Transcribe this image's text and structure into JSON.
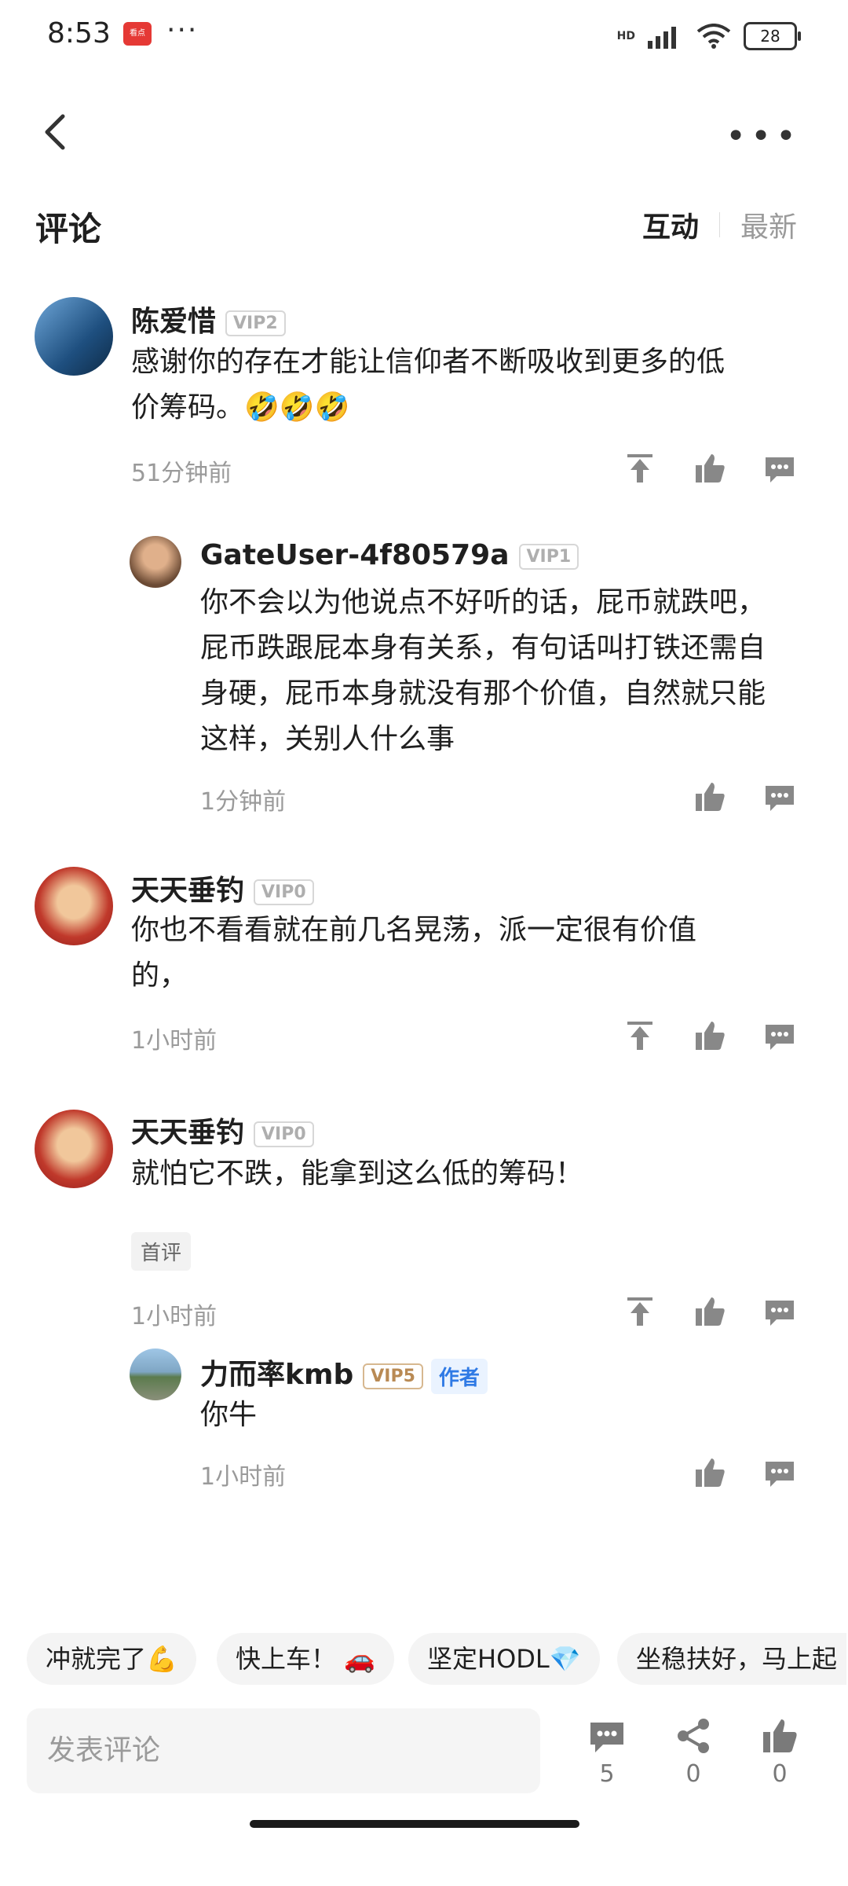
{
  "status_bar": {
    "time": "8:53",
    "app_icon_label": "看点",
    "dots": "···",
    "network": "HD",
    "battery": "28"
  },
  "header": {
    "back_icon": "back-chevron-icon",
    "more_icon": "more-icon",
    "title": "评论",
    "tabs": [
      "互动",
      "最新"
    ]
  },
  "comments": [
    {
      "name": "陈爱惜",
      "vip": "VIP2",
      "text_line1": "感谢你的存在才能让信仰者不断吸收到更多的低",
      "text_line2": "价筹码。🤣🤣🤣",
      "time": "51分钟前"
    },
    {
      "name": "GateUser-4f80579a",
      "vip": "VIP1",
      "lines": [
        "你不会以为他说点不好听的话，屁币就跌吧，",
        "屁币跌跟屁本身有关系，有句话叫打铁还需自",
        "身硬，屁币本身就没有那个价值，自然就只能",
        "这样，关别人什么事"
      ],
      "time": "1分钟前"
    },
    {
      "name": "天天垂钓",
      "vip": "VIP0",
      "lines": [
        "你也不看看就在前几名晃荡，派一定很有价值",
        "的，"
      ],
      "time": "1小时前"
    },
    {
      "name": "天天垂钓",
      "vip": "VIP0",
      "lines": [
        "就怕它不跌，能拿到这么低的筹码！"
      ],
      "tag": "首评",
      "time": "1小时前"
    },
    {
      "name": "力而率kmb",
      "vip": "VIP5",
      "author": "作者",
      "lines": [
        "你牛"
      ],
      "time": "1小时前"
    }
  ],
  "quick_replies": [
    "冲就完了💪",
    "快上车！ 🚗",
    "坚定HODL💎",
    "坐稳扶好，马上起"
  ],
  "bottom_bar": {
    "input_placeholder": "发表评论",
    "comment_count": "5",
    "share_count": "0",
    "like_count": "0"
  },
  "colors": {
    "accent_blue": "#2f7ae5",
    "vip_gold": "#b98a54",
    "muted": "#9a9a9a"
  }
}
